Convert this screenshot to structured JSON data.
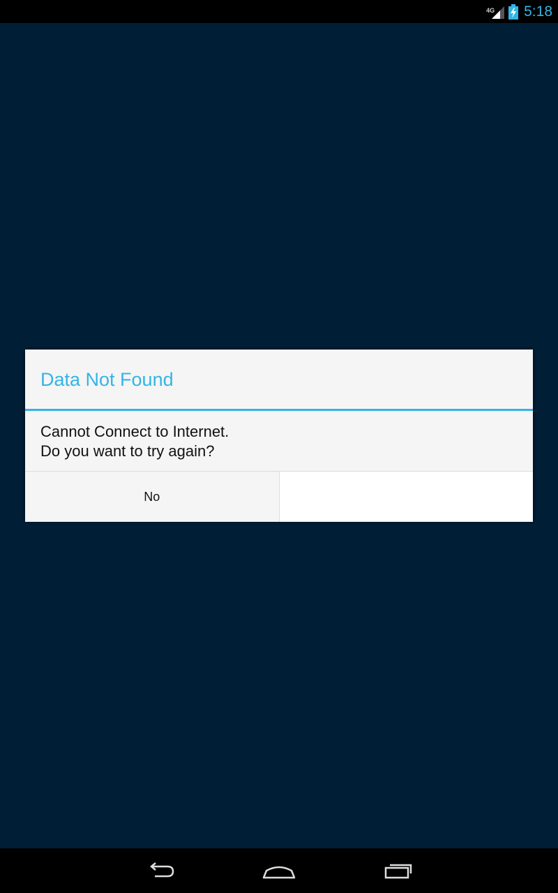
{
  "status_bar": {
    "network_label": "4G",
    "time": "5:18",
    "icons": [
      "signal-icon",
      "battery-charging-icon"
    ],
    "accent_color": "#33b5e5"
  },
  "dialog": {
    "title": "Data Not Found",
    "message_line1": "Cannot Connect to Internet.",
    "message_line2": "Do you want to try again?",
    "negative_button": "No",
    "positive_button": "",
    "title_color": "#33b5e5"
  },
  "nav_bar": {
    "icons": [
      "back-icon",
      "home-icon",
      "recent-apps-icon"
    ]
  },
  "background_color": "#001f37"
}
